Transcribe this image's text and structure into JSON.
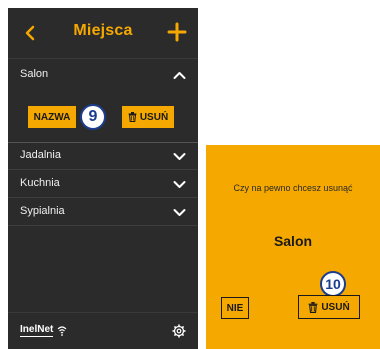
{
  "app": {
    "title": "Miejsca",
    "rooms": [
      {
        "label": "Salon",
        "expanded": true
      },
      {
        "label": "Jadalnia",
        "expanded": false
      },
      {
        "label": "Kuchnia",
        "expanded": false
      },
      {
        "label": "Sypialnia",
        "expanded": false
      }
    ],
    "actions": {
      "rename_label": "NAZWA",
      "delete_label": "USUŃ"
    },
    "footer": {
      "logo": "InelNet"
    }
  },
  "callouts": {
    "step1": "9",
    "step2": "10"
  },
  "dialog": {
    "question": "Czy na pewno chcesz usunąć",
    "room_name": "Salon",
    "no_label": "NIE",
    "yes_label": "USUŃ"
  },
  "colors": {
    "accent": "#f5a800",
    "background": "#2b2b2b",
    "badge": "#1a3d8f"
  },
  "icons": [
    "back-icon",
    "plus-icon",
    "chevron-up-icon",
    "chevron-down-icon",
    "trash-icon",
    "wifi-icon",
    "gear-icon"
  ]
}
